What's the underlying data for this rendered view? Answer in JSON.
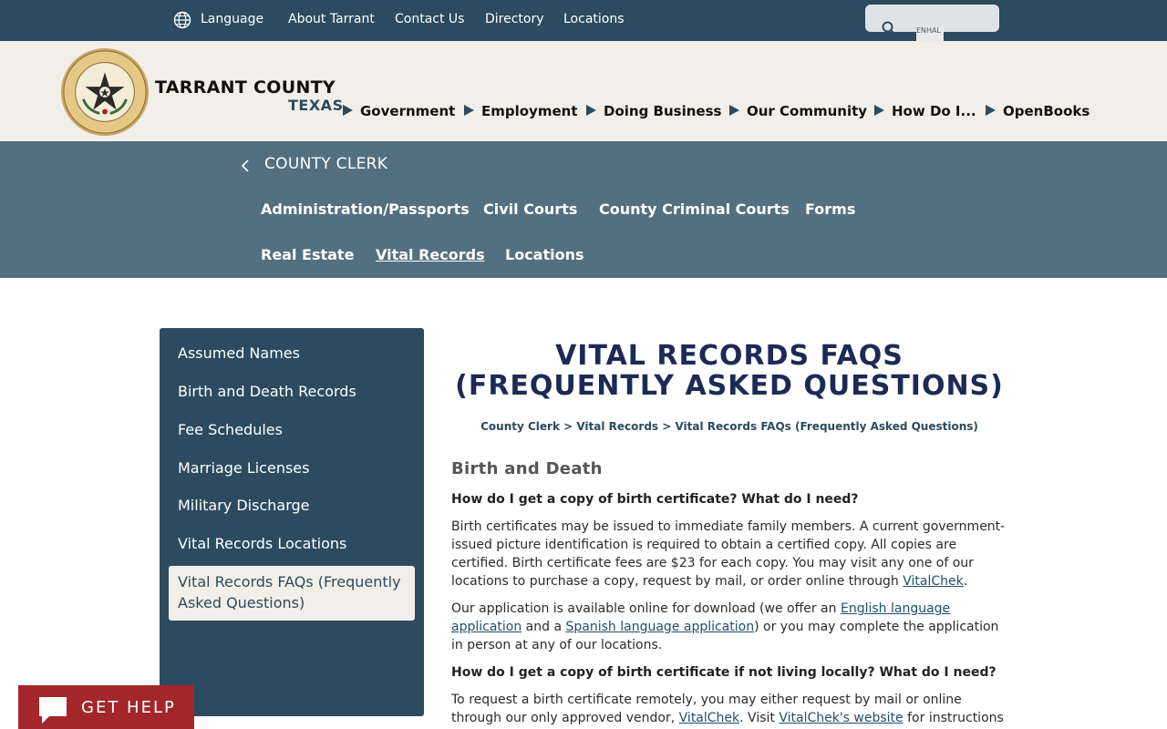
{
  "topbar": {
    "language": "Language",
    "links": [
      "About Tarrant",
      "Contact Us",
      "Directory",
      "Locations"
    ],
    "enhance_label": "ENHAL"
  },
  "header": {
    "brand_name": "TARRANT COUNTY",
    "brand_state": "TEXAS",
    "nav": [
      "Government",
      "Employment",
      "Doing Business",
      "Our Community",
      "How Do I...",
      "OpenBooks"
    ]
  },
  "department": {
    "title": "COUNTY CLERK",
    "links": [
      "Administration/Passports",
      "Civil Courts",
      "County Criminal Courts",
      "Forms",
      "Real Estate",
      "Vital Records",
      "Locations"
    ],
    "active": "Vital Records"
  },
  "sidebar": {
    "items": [
      "Assumed Names",
      "Birth and Death Records",
      "Fee Schedules",
      "Marriage Licenses",
      "Military Discharge",
      "Vital Records Locations"
    ],
    "active_line1": "Vital Records FAQs (Frequently",
    "active_line2": "Asked Questions)"
  },
  "main": {
    "title_line1": "VITAL RECORDS FAQS",
    "title_line2": "(FREQUENTLY ASKED QUESTIONS)",
    "breadcrumb": "County Clerk > Vital Records > Vital Records FAQs (Frequently Asked Questions)",
    "section": "Birth and Death",
    "q1": "How do I get a copy of birth certificate? What do I need?",
    "a1_text": "Birth certificates may be issued to immediate family members. A current government-issued picture identification is required to obtain a certified copy. All copies are certified. Birth certificate fees are $23 for each copy. You may visit any one of our locations to purchase a copy, request by mail, or order online through ",
    "a1_link": "VitalChek",
    "a1_end": ".",
    "a2_start": "Our application is available online for download (we offer an ",
    "a2_link1": "English language application",
    "a2_mid": " and a ",
    "a2_link2": "Spanish language application",
    "a2_end": ") or you may complete the application in person at any of our locations.",
    "q2": "How do I get a copy of birth certificate if not living locally? What do I need?",
    "a3_start": "To request a birth certificate remotely, you may either request by mail or online through our only approved vendor, ",
    "a3_link1": "VitalChek",
    "a3_mid": ". Visit ",
    "a3_link2": "VitalChek's website",
    "a3_end": " for instructions"
  },
  "help": {
    "label": "GET HELP"
  }
}
